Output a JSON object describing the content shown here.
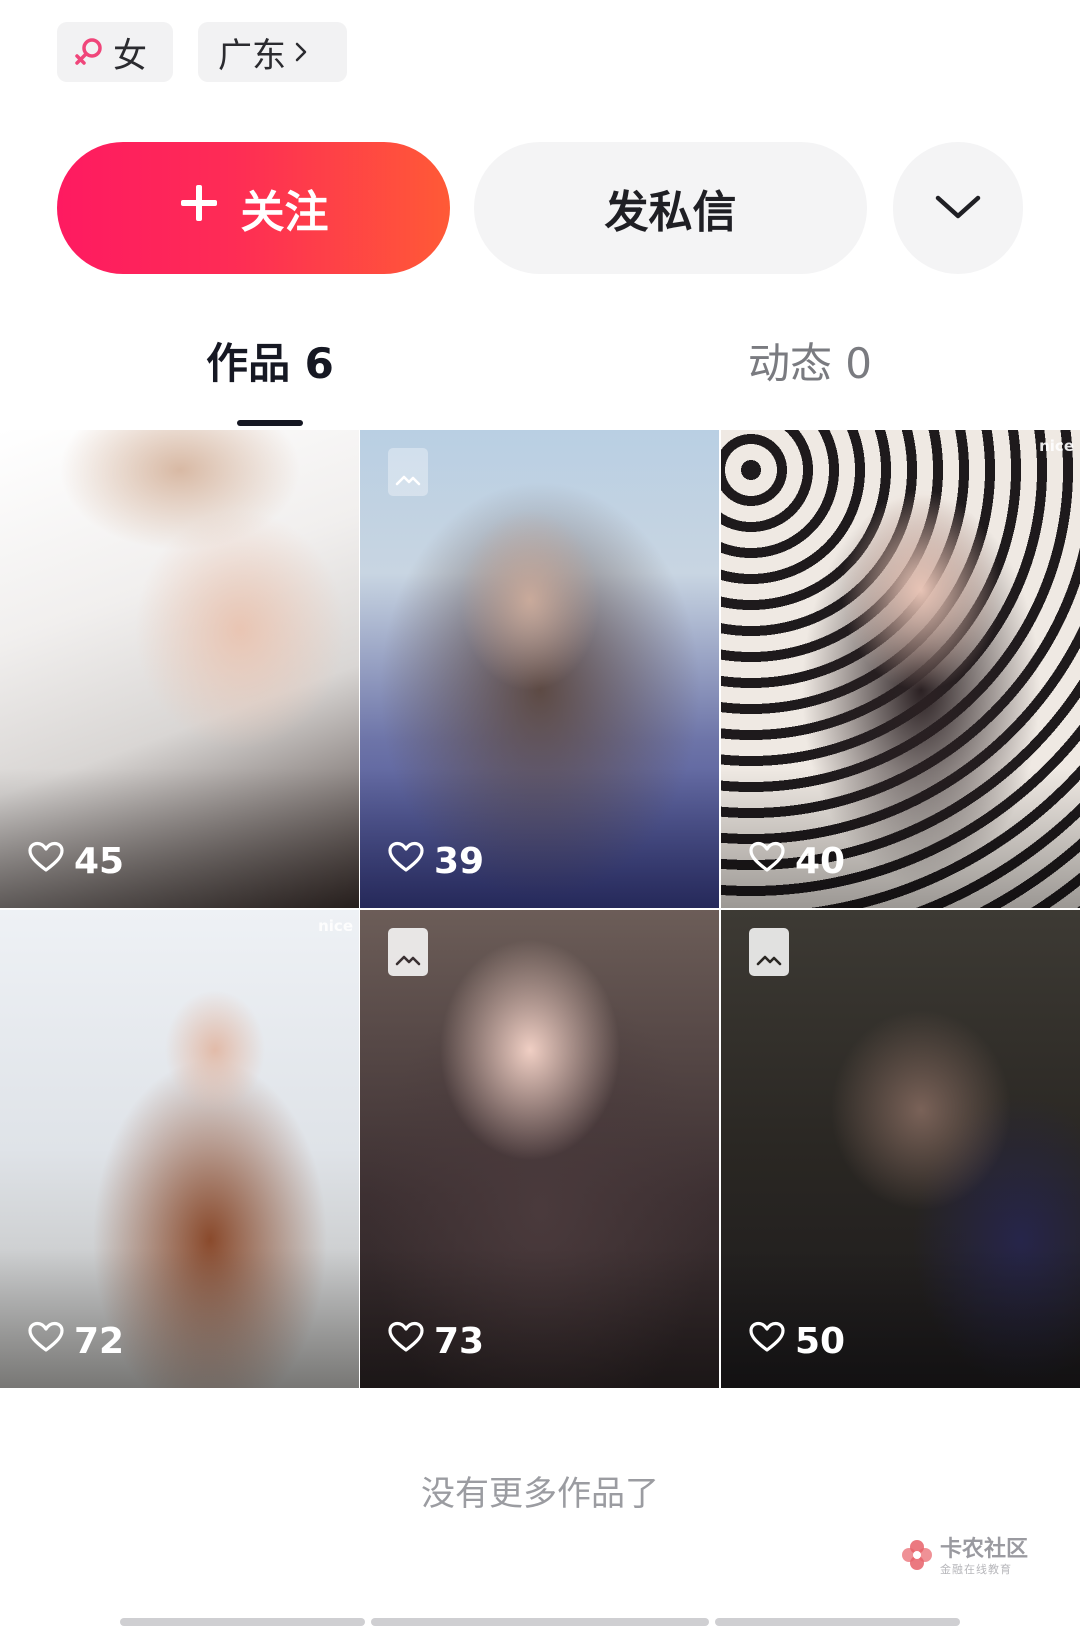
{
  "profile_tags": {
    "gender": "女",
    "location": "广东"
  },
  "actions": {
    "follow_label": "关注",
    "message_label": "发私信"
  },
  "tabs": [
    {
      "label": "作品 6",
      "active": true
    },
    {
      "label": "动态 0",
      "active": false
    }
  ],
  "works": [
    {
      "likes": "45",
      "image_badge": false,
      "watermark": ""
    },
    {
      "likes": "39",
      "image_badge": true,
      "watermark": ""
    },
    {
      "likes": "40",
      "image_badge": false,
      "watermark": "nice"
    },
    {
      "likes": "72",
      "image_badge": false,
      "watermark": "nice"
    },
    {
      "likes": "73",
      "image_badge": true,
      "watermark": ""
    },
    {
      "likes": "50",
      "image_badge": true,
      "watermark": ""
    }
  ],
  "footer_text": "没有更多作品了",
  "site_watermark": {
    "name": "卡农社区",
    "tagline": "金融在线教育"
  },
  "colors": {
    "accent_gradient_start": "#fe1a61",
    "accent_gradient_end": "#ff5a36",
    "gender_icon": "#f0467a"
  },
  "icons": [
    "female-icon",
    "chevron-right-icon",
    "plus-icon",
    "chevron-down-icon",
    "heart-icon",
    "image-icon"
  ]
}
